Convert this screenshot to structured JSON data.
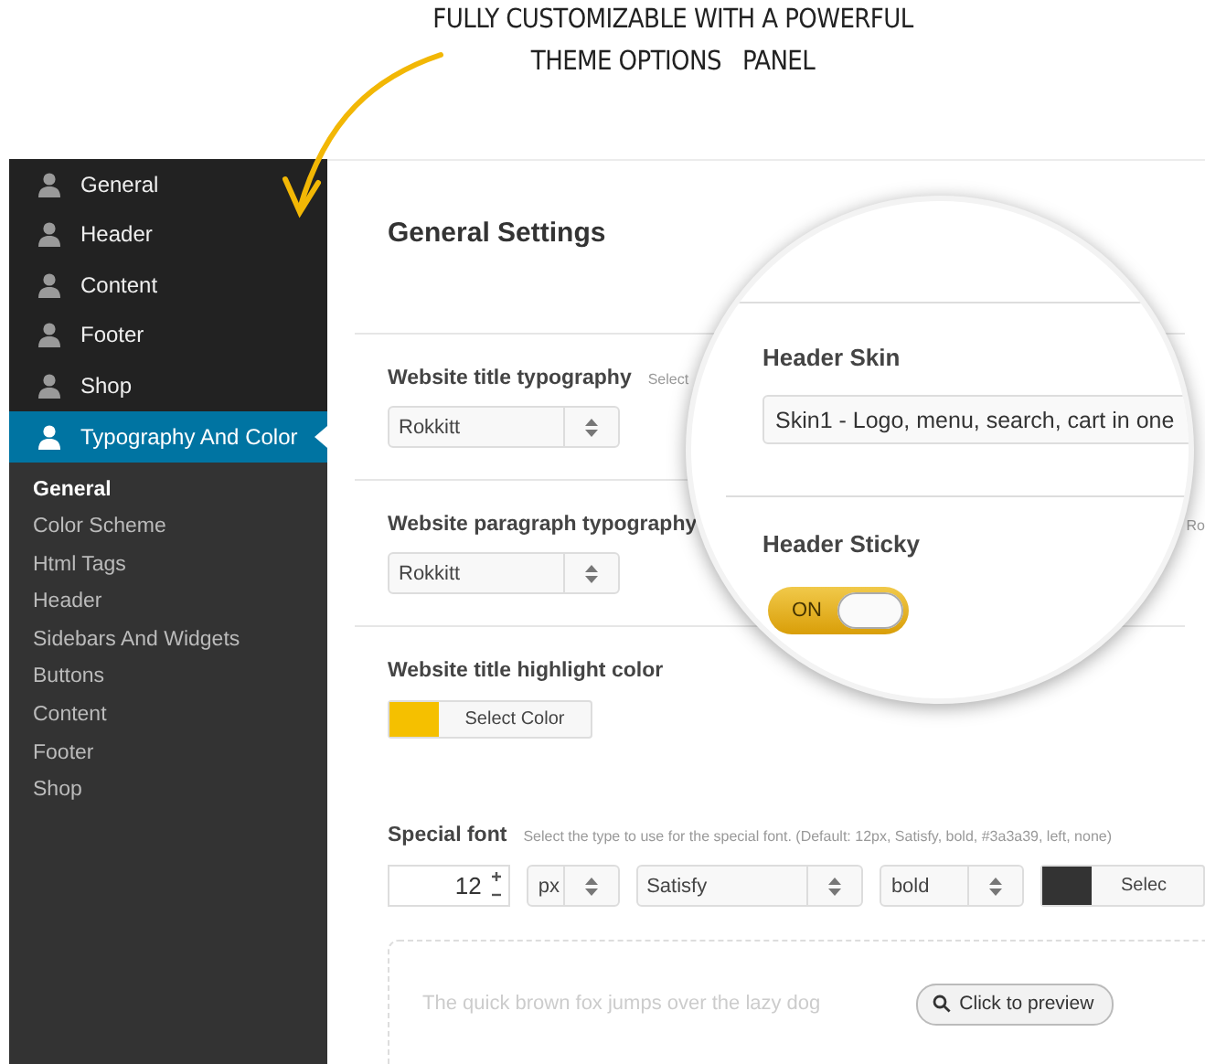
{
  "annotation": {
    "lines": [
      "FULLY CUSTOMIZABLE WITH A POWERFUL",
      "THEME OPTIONS   PANEL"
    ]
  },
  "sidebar": {
    "items": [
      {
        "label": "General",
        "selected": false
      },
      {
        "label": "Header",
        "selected": false
      },
      {
        "label": "Content",
        "selected": false
      },
      {
        "label": "Footer",
        "selected": false
      },
      {
        "label": "Shop",
        "selected": false
      },
      {
        "label": "Typography And Color",
        "selected": true,
        "children": [
          {
            "label": "General",
            "selected": true
          },
          {
            "label": "Color Scheme",
            "selected": false
          },
          {
            "label": "Html Tags",
            "selected": false
          },
          {
            "label": "Header",
            "selected": false
          },
          {
            "label": "Sidebars And Widgets",
            "selected": false
          },
          {
            "label": "Buttons",
            "selected": false
          },
          {
            "label": "Content",
            "selected": false
          },
          {
            "label": "Footer",
            "selected": false
          },
          {
            "label": "Shop",
            "selected": false
          }
        ]
      }
    ]
  },
  "page_title": "General Settings",
  "settings": [
    {
      "kind": "select",
      "label": "Website title typography",
      "hint": "Select",
      "value": "Rokkitt"
    },
    {
      "kind": "select",
      "label": "Website paragraph typography",
      "side_hint": "Ro",
      "value": "Rokkitt"
    },
    {
      "kind": "color",
      "label": "Website title highlight color",
      "color": "#f5c000",
      "button": "Select Color"
    }
  ],
  "special_font": {
    "label": "Special font",
    "hint": "Select the type to use for the special font. (Default: 12px, Satisfy, bold, #3a3a39, left, none)",
    "size": "12",
    "unit": "px",
    "family": "Satisfy",
    "weight": "bold",
    "color": "#333333",
    "color_button": "Selec",
    "preview_text": "The quick brown fox jumps over the lazy dog",
    "preview_button": "Click to preview"
  },
  "magnifier": {
    "header_skin": {
      "label": "Header Skin",
      "value": "Skin1 - Logo, menu, search, cart in one"
    },
    "header_sticky": {
      "label": "Header Sticky",
      "toggle": {
        "label": "ON",
        "on": true
      }
    }
  }
}
